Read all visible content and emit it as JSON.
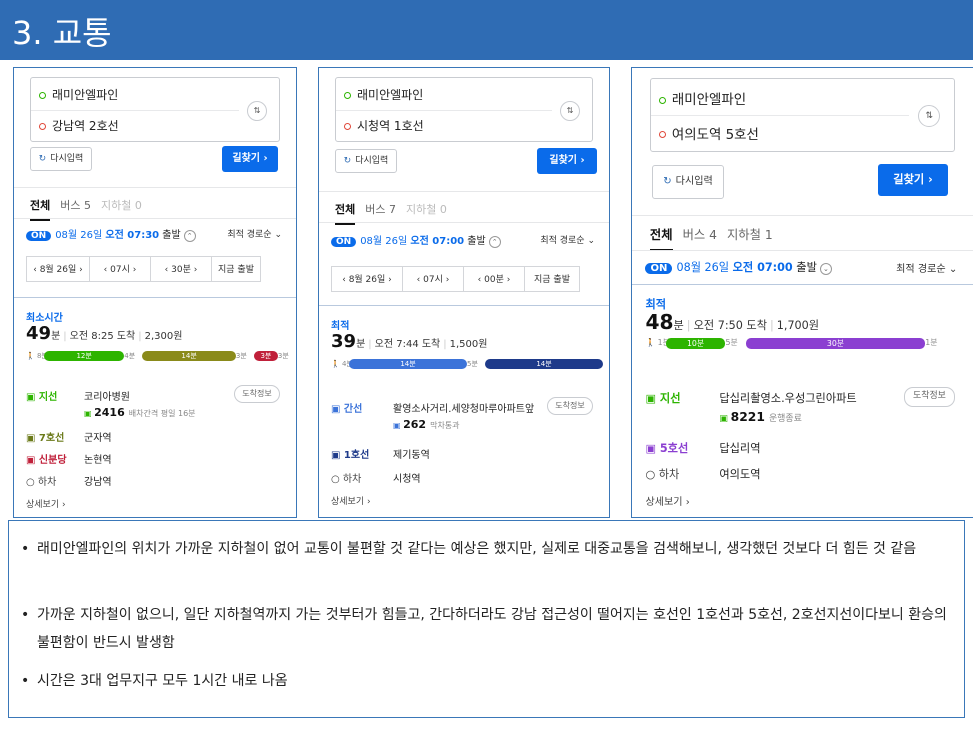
{
  "title": "3. 교통",
  "panels": [
    {
      "origin": "래미안엘파인",
      "destination": "강남역 2호선",
      "reset_label": "다시입력",
      "search_label": "길찾기 ›",
      "tabs": [
        "전체",
        "버스 5",
        "지하철 0"
      ],
      "departure": {
        "badge": "ON",
        "date": "08월 26일",
        "time": "오전 07:30",
        "suffix": "출발"
      },
      "sort": "최적 경로순",
      "selectors": [
        "‹ 8월 26일 ›",
        "‹ 07시 ›",
        "‹ 30분 ›",
        "지금 출발"
      ],
      "label": "최소시간",
      "minutes": "49",
      "min_unit": "분",
      "arrival": "오전 8:25 도착",
      "fare": "2,300원",
      "segments": [
        {
          "text": "8분",
          "kind": "walk"
        },
        {
          "text": "12분",
          "kind": "bus",
          "color": "#2db400"
        },
        {
          "text": "4분",
          "kind": "walk"
        },
        {
          "text": "14분",
          "kind": "subway",
          "color": "#8a8a1a"
        },
        {
          "text": "3분",
          "kind": "walk"
        },
        {
          "text": "3분",
          "kind": "subway",
          "color": "#c0203a"
        },
        {
          "text": "3분",
          "kind": "walk"
        }
      ],
      "steps": [
        {
          "name": "지선",
          "value": "코리아병원",
          "color": "#2db400",
          "chip": "도착정보",
          "bus_no": "2416",
          "bus_note": "배차간격 평일 16분"
        },
        {
          "name": "7호선",
          "value": "군자역",
          "color": "#6b7a1a"
        },
        {
          "name": "신분당",
          "value": "논현역",
          "color": "#c0203a"
        },
        {
          "name": "하차",
          "value": "강남역",
          "color": "#666"
        }
      ],
      "detail": "상세보기 ›"
    },
    {
      "origin": "래미안엘파인",
      "destination": "시청역 1호선",
      "reset_label": "다시입력",
      "search_label": "길찾기 ›",
      "tabs": [
        "전체",
        "버스 7",
        "지하철 0"
      ],
      "departure": {
        "badge": "ON",
        "date": "08월 26일",
        "time": "오전 07:00",
        "suffix": "출발"
      },
      "sort": "최적 경로순",
      "selectors": [
        "‹ 8월 26일 ›",
        "‹ 07시 ›",
        "‹ 00분 ›",
        "지금 출발"
      ],
      "label": "최적",
      "minutes": "39",
      "min_unit": "분",
      "arrival": "오전 7:44 도착",
      "fare": "1,500원",
      "segments": [
        {
          "text": "4분",
          "kind": "walk"
        },
        {
          "text": "14분",
          "kind": "bus",
          "color": "#3b73d9"
        },
        {
          "text": "5분",
          "kind": "walk"
        },
        {
          "text": "14분",
          "kind": "subway",
          "color": "#1e3a8a"
        }
      ],
      "steps": [
        {
          "name": "간선",
          "value": "활영소사거리.세양청마루아파트앞",
          "color": "#3b73d9",
          "chip": "도착정보",
          "bus_no": "262",
          "bus_note": "막차통과"
        },
        {
          "name": "1호선",
          "value": "제기동역",
          "color": "#1e3a8a"
        },
        {
          "name": "하차",
          "value": "시청역",
          "color": "#666"
        }
      ],
      "detail": "상세보기 ›"
    },
    {
      "origin": "래미안엘파인",
      "destination": "여의도역 5호선",
      "reset_label": "다시입력",
      "search_label": "길찾기 ›",
      "tabs": [
        "전체",
        "버스 4",
        "지하철 1"
      ],
      "departure": {
        "badge": "ON",
        "date": "08월 26일",
        "time": "오전 07:00",
        "suffix": "출발"
      },
      "sort": "최적 경로순",
      "selectors": [],
      "label": "최적",
      "minutes": "48",
      "min_unit": "분",
      "arrival": "오전 7:50 도착",
      "fare": "1,700원",
      "segments": [
        {
          "text": "1분",
          "kind": "walk"
        },
        {
          "text": "10분",
          "kind": "bus",
          "color": "#2db400"
        },
        {
          "text": "5분",
          "kind": "walk"
        },
        {
          "text": "30분",
          "kind": "subway",
          "color": "#8b3fd1"
        },
        {
          "text": "1분",
          "kind": "walk"
        }
      ],
      "steps": [
        {
          "name": "지선",
          "value": "답십리촬영소.우성그린아파트",
          "color": "#2db400",
          "chip": "도착정보",
          "bus_no": "8221",
          "bus_note": "운행종료"
        },
        {
          "name": "5호선",
          "value": "답십리역",
          "color": "#8b3fd1"
        },
        {
          "name": "하차",
          "value": "여의도역",
          "color": "#666"
        }
      ],
      "detail": "상세보기 ›"
    }
  ],
  "notes": [
    "래미안엘파인의 위치가 가까운 지하철이 없어 교통이 불편할 것 같다는 예상은 했지만, 실제로 대중교통을 검색해보니, 생각했던 것보다 더 힘든 것 같음",
    "가까운 지하철이 없으니, 일단 지하철역까지 가는 것부터가 힘들고, 간다하더라도 강남 접근성이 떨어지는 호선인 1호선과 5호선, 2호선지선이다보니 환승의 불편함이 반드시 발생함",
    "시간은 3대 업무지구 모두 1시간 내로 나옴"
  ]
}
